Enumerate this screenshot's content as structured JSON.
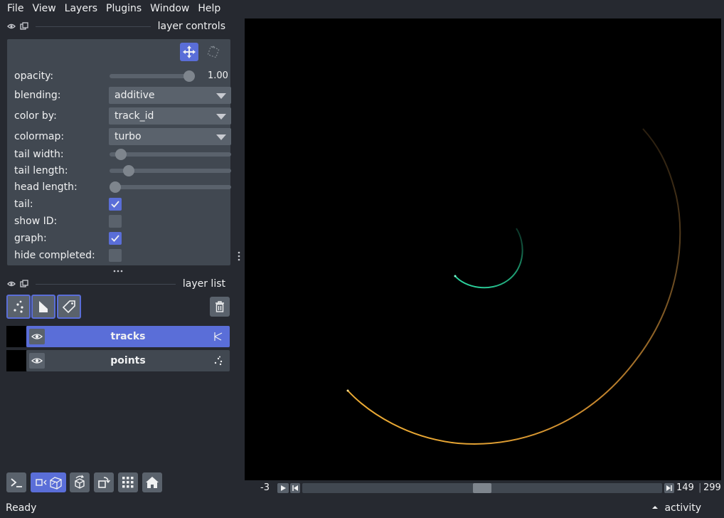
{
  "menubar": {
    "items": [
      "File",
      "View",
      "Layers",
      "Plugins",
      "Window",
      "Help"
    ]
  },
  "layer_controls": {
    "title": "layer controls",
    "header_icons": [
      "eye-float-icon",
      "undock-icon"
    ],
    "mode_buttons": [
      "pan-zoom-icon",
      "transform-icon"
    ],
    "opacity_label": "opacity:",
    "opacity_value": "1.00",
    "opacity_level": 1.0,
    "blending_label": "blending:",
    "blending_value": "additive",
    "color_by_label": "color by:",
    "color_by_value": "track_id",
    "colormap_label": "colormap:",
    "colormap_value": "turbo",
    "tail_width_label": "tail width:",
    "tail_width_level": 0.05,
    "tail_length_label": "tail length:",
    "tail_length_level": 0.12,
    "head_length_label": "head length:",
    "head_length_level": 0.0,
    "tail_label": "tail:",
    "tail_checked": true,
    "show_id_label": "show ID:",
    "show_id_checked": false,
    "graph_label": "graph:",
    "graph_checked": true,
    "hide_completed_label": "hide completed:",
    "hide_completed_checked": false
  },
  "layer_list": {
    "title": "layer list",
    "buttons": [
      "new-points-layer-icon",
      "new-shapes-layer-icon",
      "new-labels-layer-icon",
      "delete-layer-icon"
    ],
    "layers": [
      {
        "name": "tracks",
        "selected": true,
        "type_icon": "tracks-icon"
      },
      {
        "name": "points",
        "selected": false,
        "type_icon": "points-icon"
      }
    ]
  },
  "bottom_tools": [
    "console-icon",
    "ndisplay-toggle-icon",
    "roll-icon",
    "transpose-icon",
    "grid-icon",
    "home-icon"
  ],
  "dims": {
    "axis_label": "-3",
    "current": "149",
    "max": "299",
    "position_fraction": 0.5
  },
  "status": {
    "text": "Ready",
    "activity": "activity"
  },
  "colors": {
    "accent": "#5a6ed8",
    "background": "#262930",
    "panel": "#414851",
    "track_inner": "#1fc28b",
    "track_outer": "#f0a030"
  }
}
